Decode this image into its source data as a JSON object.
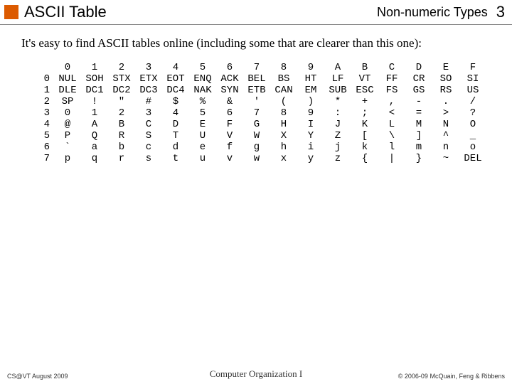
{
  "header": {
    "title": "ASCII Table",
    "subtitle": "Non-numeric Types",
    "page": "3"
  },
  "intro": "It's easy to find ASCII tables online (including some that are clearer than this one):",
  "table": {
    "cols": [
      "0",
      "1",
      "2",
      "3",
      "4",
      "5",
      "6",
      "7",
      "8",
      "9",
      "A",
      "B",
      "C",
      "D",
      "E",
      "F"
    ],
    "rows": [
      {
        "label": "0",
        "cells": [
          "NUL",
          "SOH",
          "STX",
          "ETX",
          "EOT",
          "ENQ",
          "ACK",
          "BEL",
          "BS",
          "HT",
          "LF",
          "VT",
          "FF",
          "CR",
          "SO",
          "SI"
        ]
      },
      {
        "label": "1",
        "cells": [
          "DLE",
          "DC1",
          "DC2",
          "DC3",
          "DC4",
          "NAK",
          "SYN",
          "ETB",
          "CAN",
          "EM",
          "SUB",
          "ESC",
          "FS",
          "GS",
          "RS",
          "US"
        ]
      },
      {
        "label": "2",
        "cells": [
          "SP",
          "!",
          "\"",
          "#",
          "$",
          "%",
          "&",
          "'",
          "(",
          ")",
          "*",
          "+",
          ",",
          "-",
          ".",
          "/"
        ]
      },
      {
        "label": "3",
        "cells": [
          "0",
          "1",
          "2",
          "3",
          "4",
          "5",
          "6",
          "7",
          "8",
          "9",
          ":",
          ";",
          "<",
          "=",
          ">",
          "?"
        ]
      },
      {
        "label": "4",
        "cells": [
          "@",
          "A",
          "B",
          "C",
          "D",
          "E",
          "F",
          "G",
          "H",
          "I",
          "J",
          "K",
          "L",
          "M",
          "N",
          "O"
        ]
      },
      {
        "label": "5",
        "cells": [
          "P",
          "Q",
          "R",
          "S",
          "T",
          "U",
          "V",
          "W",
          "X",
          "Y",
          "Z",
          "[",
          "\\",
          "]",
          "^",
          "_"
        ]
      },
      {
        "label": "6",
        "cells": [
          "`",
          "a",
          "b",
          "c",
          "d",
          "e",
          "f",
          "g",
          "h",
          "i",
          "j",
          "k",
          "l",
          "m",
          "n",
          "o"
        ]
      },
      {
        "label": "7",
        "cells": [
          "p",
          "q",
          "r",
          "s",
          "t",
          "u",
          "v",
          "w",
          "x",
          "y",
          "z",
          "{",
          "|",
          "}",
          "~",
          "DEL"
        ]
      }
    ]
  },
  "footer": {
    "left": "CS@VT August 2009",
    "center": "Computer Organization I",
    "right": "© 2006-09 McQuain, Feng & Ribbens"
  }
}
